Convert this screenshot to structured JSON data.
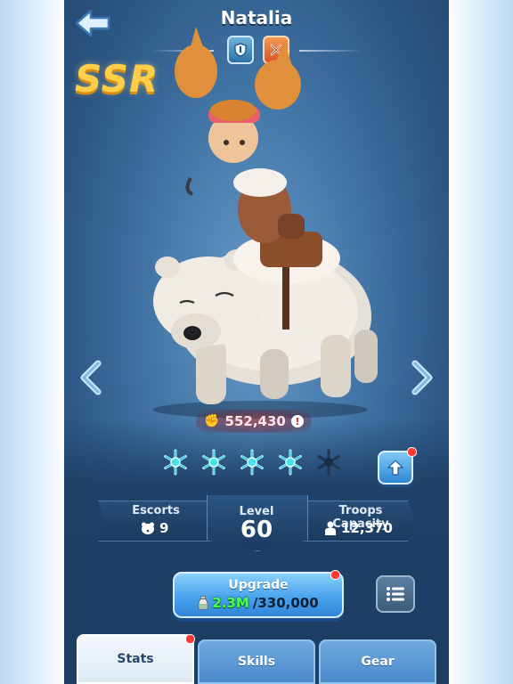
{
  "header": {
    "hero_name": "Natalia",
    "rarity": "SSR",
    "class_badges": [
      "shield-icon",
      "crossed-swords-icon"
    ]
  },
  "hero": {
    "power": "552,430",
    "stars_filled": 4,
    "stars_total": 5
  },
  "info": {
    "escorts_label": "Escorts",
    "escorts_value": "9",
    "level_label": "Level",
    "level_value": "60",
    "troops_label": "Troops Capacity",
    "troops_value": "12,370"
  },
  "upgrade": {
    "label": "Upgrade",
    "have": "2.3M",
    "need": "/330,000"
  },
  "tabs": [
    {
      "label": "Stats",
      "active": true,
      "notify": true
    },
    {
      "label": "Skills",
      "active": false,
      "notify": false
    },
    {
      "label": "Gear",
      "active": false,
      "notify": false
    }
  ],
  "colors": {
    "rarity_gold": "#ffcf4a",
    "star_cyan": "#3fe6f0",
    "notify_red": "#ff3b30",
    "have_green": "#4bff5a"
  }
}
